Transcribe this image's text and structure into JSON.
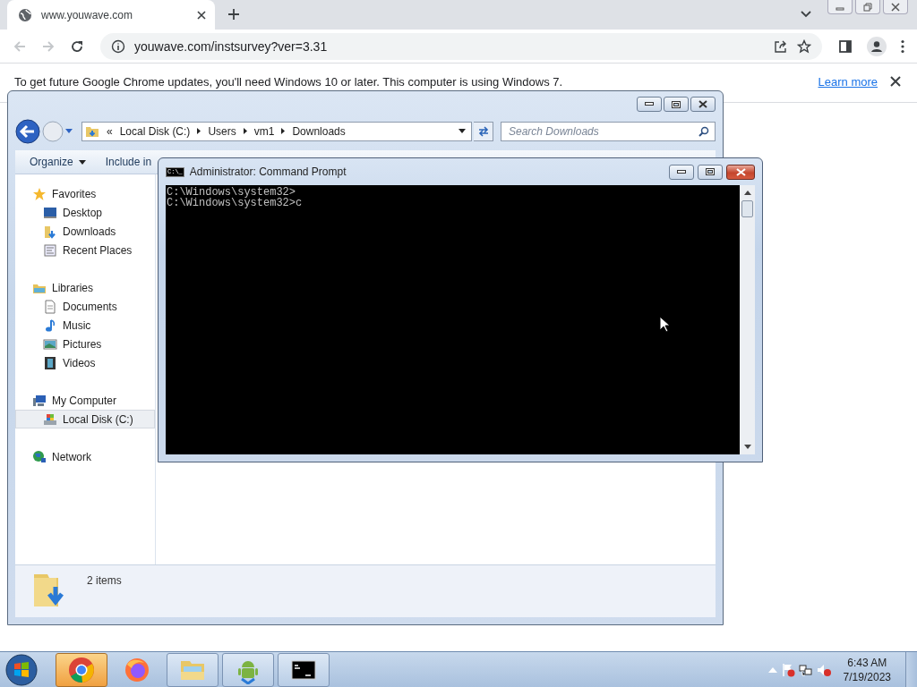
{
  "browser": {
    "tab": {
      "title": "www.youwave.com"
    },
    "address": "youwave.com/instsurvey?ver=3.31",
    "infobar": {
      "message": "To get future Google Chrome updates, you'll need Windows 10 or later. This computer is using Windows 7.",
      "link": "Learn more"
    }
  },
  "explorer": {
    "overflow": "«",
    "breadcrumb": [
      "Local Disk (C:)",
      "Users",
      "vm1",
      "Downloads"
    ],
    "search": {
      "placeholder": "Search Downloads"
    },
    "toolbar": [
      "Organize",
      "Include in"
    ],
    "sidebar": [
      {
        "label": "Favorites",
        "kind": "star",
        "selected": false,
        "children": [
          {
            "label": "Desktop",
            "kind": "desktop",
            "selected": false
          },
          {
            "label": "Downloads",
            "kind": "downloads",
            "selected": false
          },
          {
            "label": "Recent Places",
            "kind": "recent",
            "selected": false
          }
        ]
      },
      {
        "label": "Libraries",
        "kind": "library",
        "selected": false,
        "children": [
          {
            "label": "Documents",
            "kind": "document",
            "selected": false
          },
          {
            "label": "Music",
            "kind": "music",
            "selected": false
          },
          {
            "label": "Pictures",
            "kind": "pictures",
            "selected": false
          },
          {
            "label": "Videos",
            "kind": "videos",
            "selected": false
          }
        ]
      },
      {
        "label": "My Computer",
        "kind": "computer",
        "selected": false,
        "children": [
          {
            "label": "Local Disk (C:)",
            "kind": "disk",
            "selected": true
          }
        ]
      },
      {
        "label": "Network",
        "kind": "network",
        "selected": false
      }
    ],
    "status": "2 items"
  },
  "console": {
    "title": "Administrator:  Command Prompt",
    "icon_text": "C:\\_",
    "lines": [
      "C:\\Windows\\system32>",
      "C:\\Windows\\system32>c"
    ]
  },
  "taskbar": {
    "apps": [
      {
        "kind": "chrome",
        "selected": true,
        "running": true
      },
      {
        "kind": "firefox",
        "selected": false,
        "running": false
      },
      {
        "kind": "explorer",
        "selected": false,
        "running": true
      },
      {
        "kind": "android",
        "selected": false,
        "running": true
      },
      {
        "kind": "cmd",
        "selected": false,
        "running": true
      }
    ],
    "clock": {
      "time": "6:43 AM",
      "date": "7/19/2023"
    }
  }
}
